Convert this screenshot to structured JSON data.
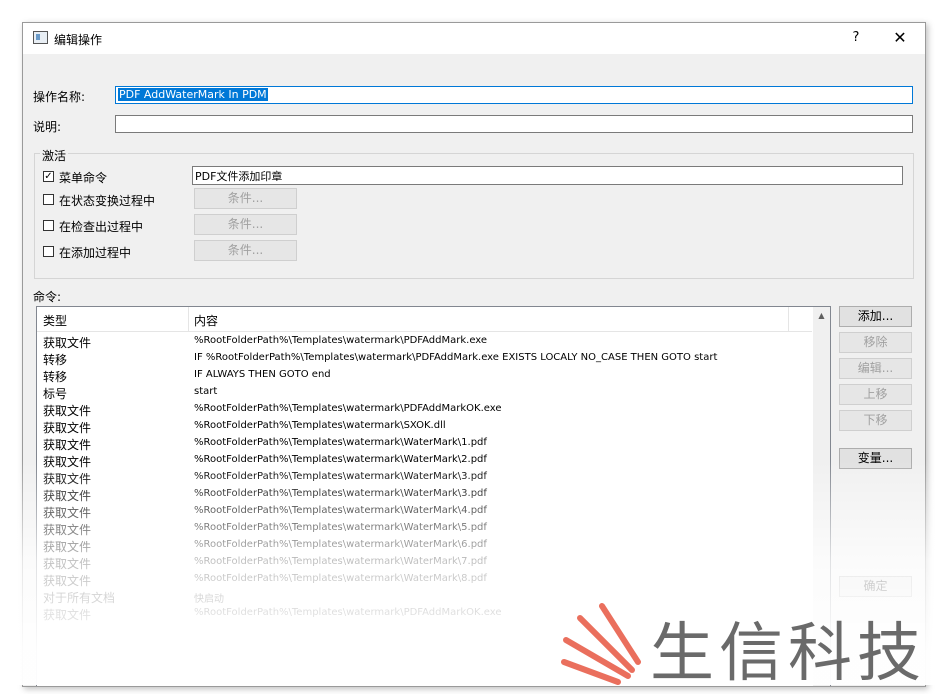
{
  "window": {
    "title": "编辑操作",
    "help_label": "?",
    "close_label": "✕"
  },
  "form": {
    "name_label": "操作名称:",
    "name_value": "PDF AddWaterMark In PDM",
    "desc_label": "说明:",
    "desc_value": ""
  },
  "activation": {
    "group_label": "激活",
    "menu_command": {
      "label": "菜单命令",
      "checked": true,
      "value": "PDF文件添加印章"
    },
    "state_change": {
      "label": "在状态变换过程中",
      "checked": false,
      "button": "条件..."
    },
    "checkout": {
      "label": "在检查出过程中",
      "checked": false,
      "button": "条件..."
    },
    "add": {
      "label": "在添加过程中",
      "checked": false,
      "button": "条件..."
    }
  },
  "commands": {
    "label": "命令:",
    "columns": [
      "类型",
      "内容"
    ],
    "rows": [
      {
        "type": "获取文件",
        "content": "%RootFolderPath%\\Templates\\watermark\\PDFAddMark.exe"
      },
      {
        "type": "转移",
        "content": "IF %RootFolderPath%\\Templates\\watermark\\PDFAddMark.exe EXISTS LOCALY  NO_CASE THEN GOTO start"
      },
      {
        "type": "转移",
        "content": "IF  ALWAYS  THEN GOTO end"
      },
      {
        "type": "标号",
        "content": "start"
      },
      {
        "type": "获取文件",
        "content": "%RootFolderPath%\\Templates\\watermark\\PDFAddMarkOK.exe"
      },
      {
        "type": "获取文件",
        "content": "%RootFolderPath%\\Templates\\watermark\\SXOK.dll"
      },
      {
        "type": "获取文件",
        "content": "%RootFolderPath%\\Templates\\watermark\\WaterMark\\1.pdf"
      },
      {
        "type": "获取文件",
        "content": "%RootFolderPath%\\Templates\\watermark\\WaterMark\\2.pdf"
      },
      {
        "type": "获取文件",
        "content": "%RootFolderPath%\\Templates\\watermark\\WaterMark\\3.pdf"
      },
      {
        "type": "获取文件",
        "content": "%RootFolderPath%\\Templates\\watermark\\WaterMark\\3.pdf"
      },
      {
        "type": "获取文件",
        "content": "%RootFolderPath%\\Templates\\watermark\\WaterMark\\4.pdf"
      },
      {
        "type": "获取文件",
        "content": "%RootFolderPath%\\Templates\\watermark\\WaterMark\\5.pdf"
      },
      {
        "type": "获取文件",
        "content": "%RootFolderPath%\\Templates\\watermark\\WaterMark\\6.pdf"
      },
      {
        "type": "获取文件",
        "content": "%RootFolderPath%\\Templates\\watermark\\WaterMark\\7.pdf"
      },
      {
        "type": "获取文件",
        "content": "%RootFolderPath%\\Templates\\watermark\\WaterMark\\8.pdf"
      },
      {
        "type": "对于所有文档",
        "content": "快启动"
      },
      {
        "type": "获取文件",
        "content": "%RootFolderPath%\\Templates\\watermark\\PDFAddMarkOK.exe"
      }
    ]
  },
  "side_buttons": {
    "add": "添加...",
    "remove": "移除",
    "edit": "编辑...",
    "move_up": "上移",
    "move_down": "下移",
    "variables": "变量...",
    "ok": "确定"
  },
  "brand_watermark": {
    "text": "生信科技",
    "icon": "fan-logo-icon",
    "accent_color": "#e8604c"
  }
}
